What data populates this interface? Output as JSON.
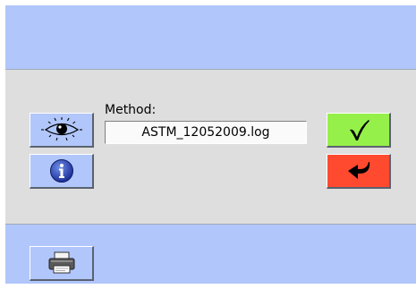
{
  "colors": {
    "panel_blue": "#b1c6fb",
    "panel_gray": "#dedede",
    "ok_green": "#96f04a",
    "cancel_red": "#ff4a30"
  },
  "icons": {
    "view": "eye-icon",
    "info": "info-icon",
    "confirm": "checkmark-icon",
    "back": "return-arrow-icon",
    "print": "printer-icon"
  },
  "method": {
    "label": "Method:",
    "value": "ASTM_12052009.log"
  }
}
